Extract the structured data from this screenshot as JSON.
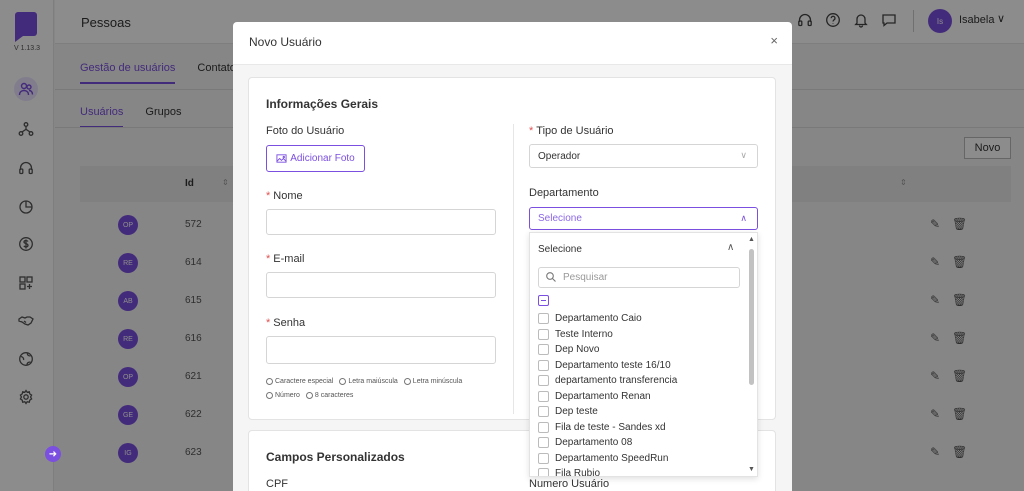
{
  "app": {
    "version": "V 1.13.3"
  },
  "topbar": {
    "title": "Pessoas",
    "user_initials": "Is",
    "user_name": "Isabela",
    "caret": "∨"
  },
  "background": {
    "tabs": [
      "Gestão de usuários",
      "Contato"
    ],
    "subtabs": [
      "Usuários",
      "Grupos"
    ],
    "new_button": "Novo",
    "table_header_id": "Id",
    "rows": [
      {
        "initials": "OP",
        "id": "572"
      },
      {
        "initials": "RE",
        "id": "614"
      },
      {
        "initials": "AB",
        "id": "615"
      },
      {
        "initials": "RE",
        "id": "616"
      },
      {
        "initials": "OP",
        "id": "621"
      },
      {
        "initials": "GE",
        "id": "622"
      },
      {
        "initials": "IG",
        "id": "623"
      }
    ]
  },
  "modal": {
    "title": "Novo Usuário",
    "close": "×",
    "section_general": "Informações Gerais",
    "photo_label": "Foto do Usuário",
    "photo_button": "Adicionar Foto",
    "name_label": "Nome",
    "email_label": "E-mail",
    "password_label": "Senha",
    "password_rules": [
      "Caractere especial",
      "Letra maiúscula",
      "Letra minúscula",
      "Número",
      "8 caracteres"
    ],
    "user_type_label": "Tipo de Usuário",
    "user_type_value": "Operador",
    "department_label": "Departamento",
    "department_placeholder": "Selecione",
    "section_custom": "Campos Personalizados",
    "cpf_label": "CPF",
    "user_number_label": "Numero Usuário"
  },
  "dropdown": {
    "header": "Selecione",
    "search_placeholder": "Pesquisar",
    "items": [
      "Departamento Caio",
      "Teste Interno",
      "Dep Novo",
      "Departamento teste 16/10",
      "departamento transferencia",
      "Departamento Renan",
      "Dep teste",
      "Fila de teste - Sandes xd",
      "Departamento 08",
      "Departamento SpeedRun",
      "Fila Rubio"
    ]
  },
  "colors": {
    "accent": "#7b4fe0",
    "required": "#e05252"
  }
}
